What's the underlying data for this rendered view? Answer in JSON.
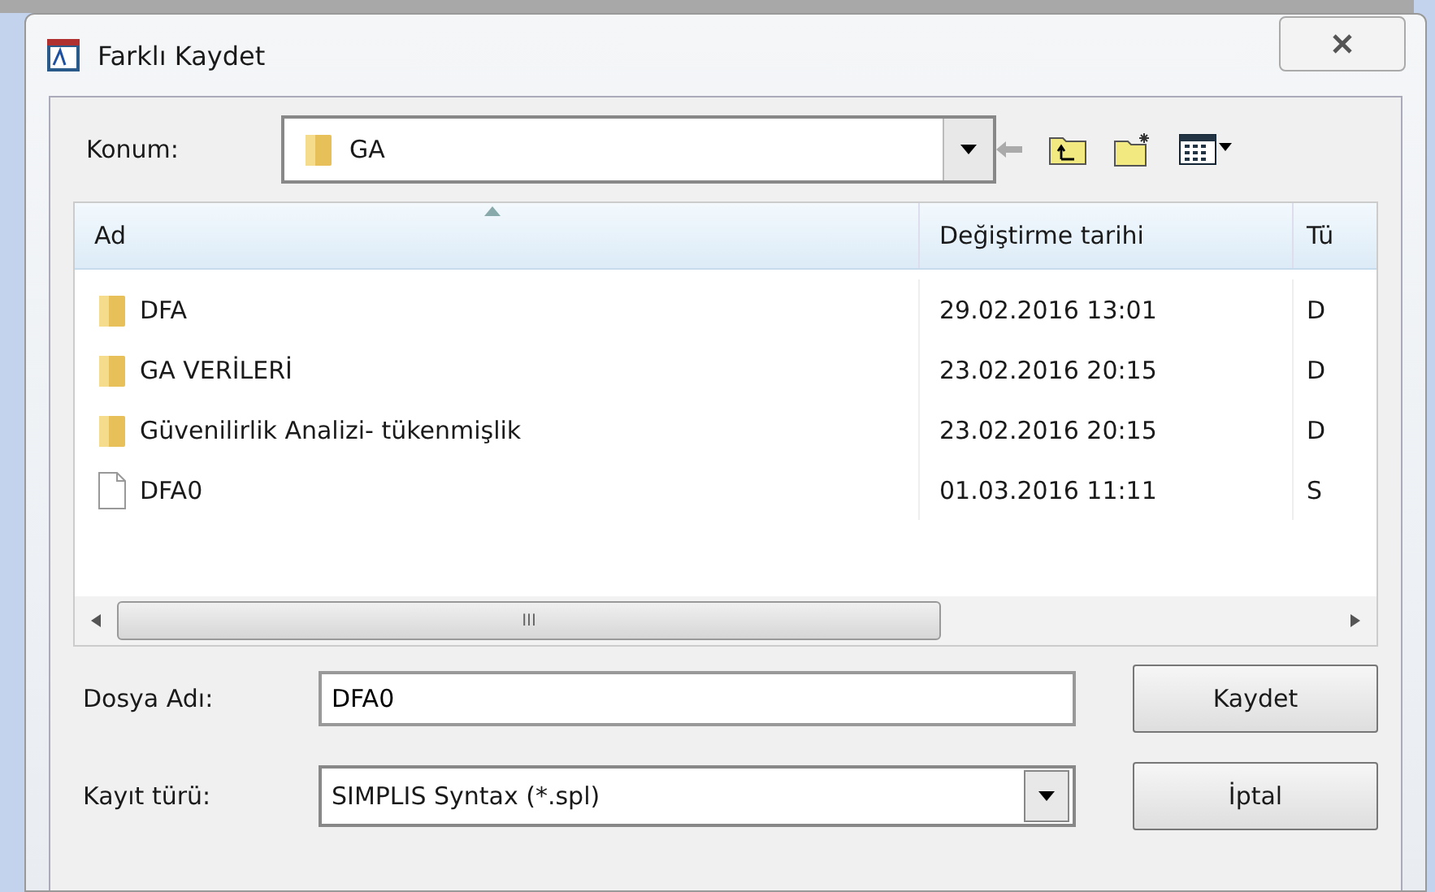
{
  "window": {
    "title": "Farklı Kaydet"
  },
  "location": {
    "label": "Konum:",
    "value": "GA"
  },
  "file_list": {
    "columns": [
      "Ad",
      "Değiştirme tarihi",
      "Tü"
    ],
    "rows": [
      {
        "kind": "folder",
        "name": "DFA",
        "date": "29.02.2016 13:01",
        "column_3": "D"
      },
      {
        "kind": "folder",
        "name": "GA VERİLERİ",
        "date": "23.02.2016 20:15",
        "column_3": "D"
      },
      {
        "kind": "folder",
        "name": "Güvenilirlik Analizi- tükenmişlik",
        "date": "23.02.2016 20:15",
        "column_3": "D"
      },
      {
        "kind": "file",
        "name": "DFA0",
        "date": "01.03.2016 11:11",
        "column_3": "S"
      }
    ]
  },
  "file_name": {
    "label": "Dosya Adı:",
    "value": "DFA0"
  },
  "file_type": {
    "label": "Kayıt türü:",
    "value": "SIMPLIS Syntax (*.spl)"
  },
  "scrollbar_grip": "III",
  "buttons": [
    "Kaydet",
    "İptal"
  ]
}
